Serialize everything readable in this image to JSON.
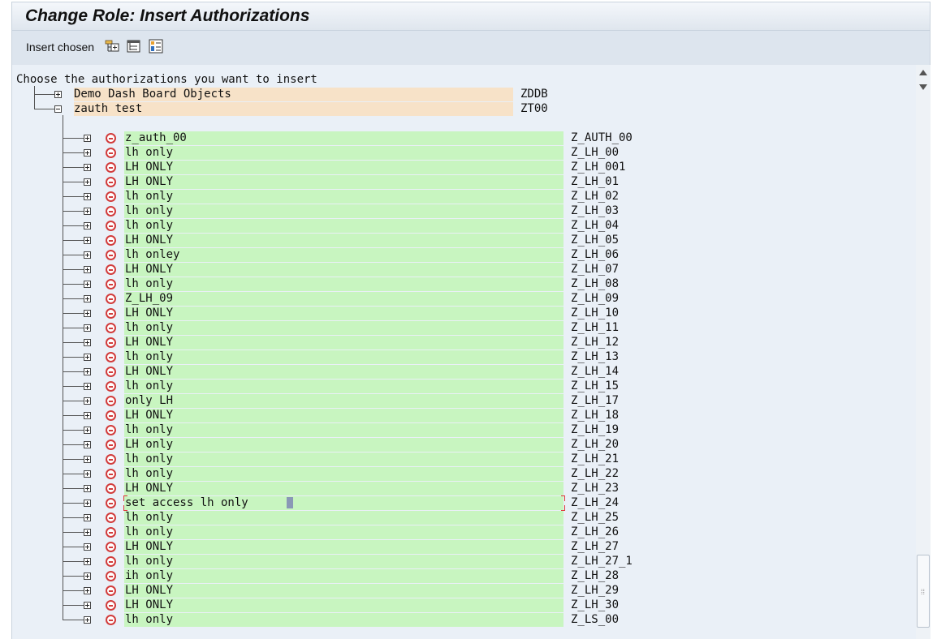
{
  "window": {
    "title": "Change Role: Insert Authorizations"
  },
  "toolbar": {
    "insert_label": "Insert chosen",
    "icons": [
      "expand-subtree-icon",
      "collapse-subtree-icon",
      "select-block-icon"
    ]
  },
  "prompt": "Choose the authorizations you want to insert",
  "top_nodes": [
    {
      "label": "Demo Dash Board Objects",
      "code": "ZDDB",
      "state": "collapsed"
    },
    {
      "label": "zauth test",
      "code": "ZT00",
      "state": "expanded"
    }
  ],
  "auth_rows": [
    {
      "label": "z_auth_00",
      "code": "Z_AUTH_00"
    },
    {
      "label": "lh only",
      "code": "Z_LH_00"
    },
    {
      "label": "LH ONLY",
      "code": "Z_LH_001"
    },
    {
      "label": "LH ONLY",
      "code": "Z_LH_01"
    },
    {
      "label": "lh only",
      "code": "Z_LH_02"
    },
    {
      "label": "lh only",
      "code": "Z_LH_03"
    },
    {
      "label": "lh only",
      "code": "Z_LH_04"
    },
    {
      "label": "LH ONLY",
      "code": "Z_LH_05"
    },
    {
      "label": "lh onley",
      "code": "Z_LH_06"
    },
    {
      "label": "LH ONLY",
      "code": "Z_LH_07"
    },
    {
      "label": "lh only",
      "code": "Z_LH_08"
    },
    {
      "label": "Z_LH_09",
      "code": "Z_LH_09"
    },
    {
      "label": "LH ONLY",
      "code": "Z_LH_10"
    },
    {
      "label": "lh only",
      "code": "Z_LH_11"
    },
    {
      "label": "LH ONLY",
      "code": "Z_LH_12"
    },
    {
      "label": "lh only",
      "code": "Z_LH_13"
    },
    {
      "label": "LH ONLY",
      "code": "Z_LH_14"
    },
    {
      "label": "lh only",
      "code": "Z_LH_15"
    },
    {
      "label": "only LH",
      "code": "Z_LH_17"
    },
    {
      "label": "LH ONLY",
      "code": "Z_LH_18"
    },
    {
      "label": "lh only",
      "code": "Z_LH_19"
    },
    {
      "label": "LH only",
      "code": "Z_LH_20"
    },
    {
      "label": "lh only",
      "code": "Z_LH_21"
    },
    {
      "label": "lh only",
      "code": "Z_LH_22"
    },
    {
      "label": "LH ONLY",
      "code": "Z_LH_23"
    },
    {
      "label": "set access lh only",
      "code": "Z_LH_24",
      "editing": true
    },
    {
      "label": "lh only",
      "code": "Z_LH_25"
    },
    {
      "label": "lh only",
      "code": "Z_LH_26"
    },
    {
      "label": "LH ONLY",
      "code": "Z_LH_27"
    },
    {
      "label": "lh only",
      "code": "Z_LH_27_1"
    },
    {
      "label": "ih only",
      "code": "Z_LH_28"
    },
    {
      "label": "LH ONLY",
      "code": "Z_LH_29"
    },
    {
      "label": "LH ONLY",
      "code": "Z_LH_30"
    },
    {
      "label": "lh only",
      "code": "Z_LS_00"
    }
  ],
  "colors": {
    "top_node_highlight": "#f7e2c8",
    "row_highlight": "#c8f5c0",
    "status_icon": "#d23c3c",
    "background": "#eaf0f7"
  }
}
